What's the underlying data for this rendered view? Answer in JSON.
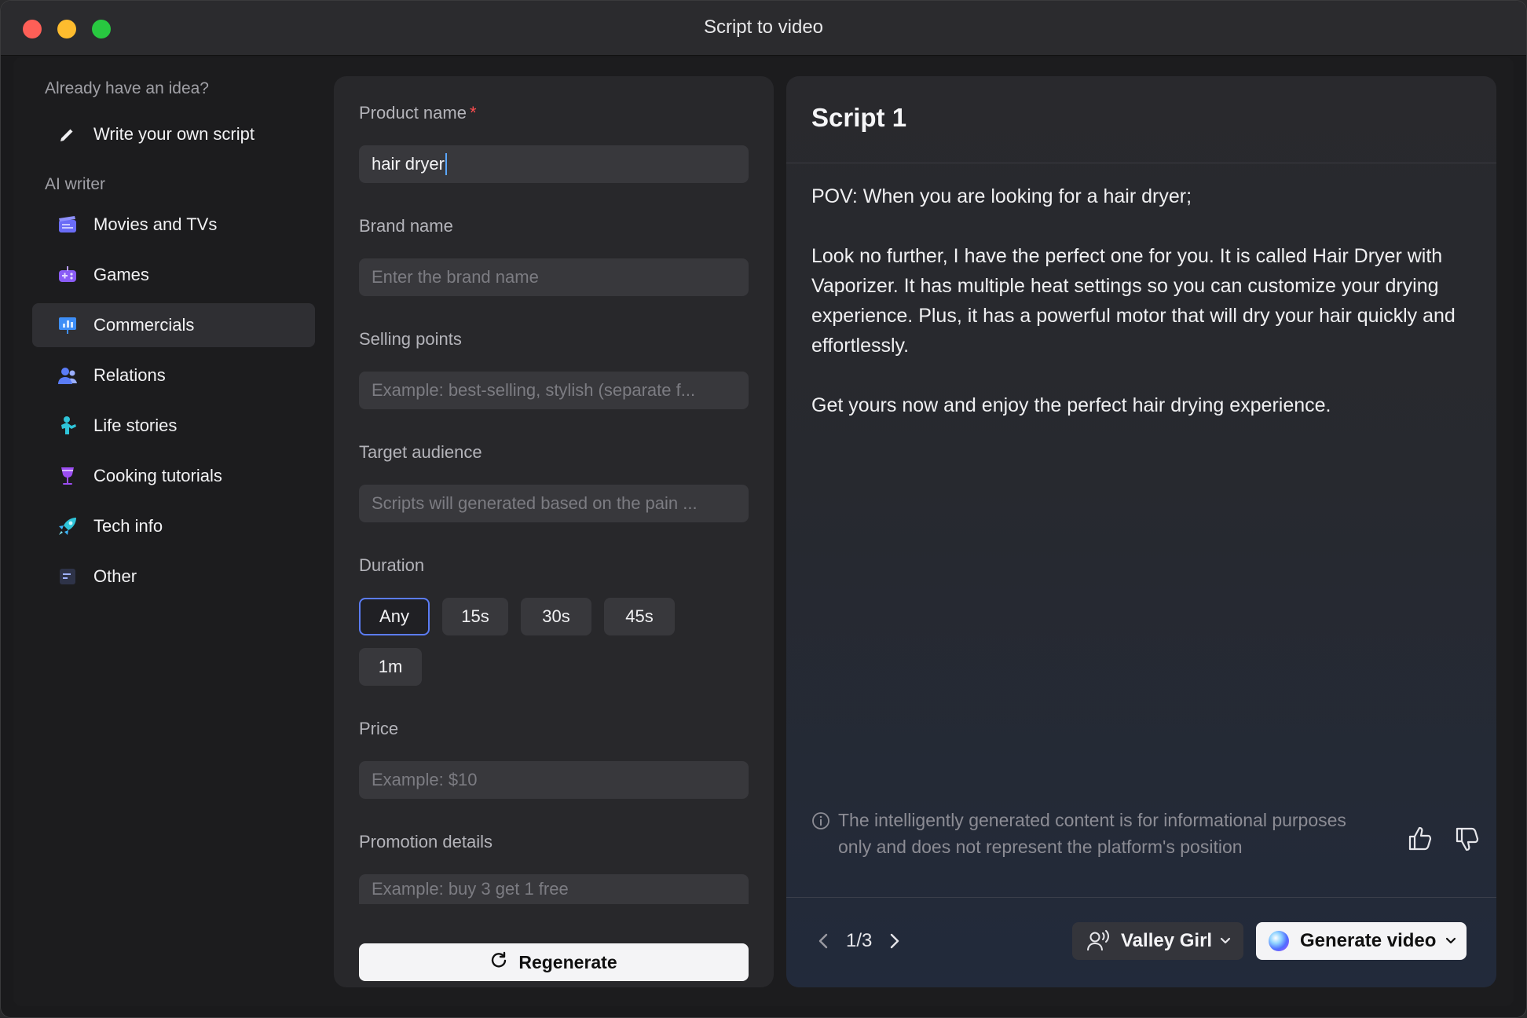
{
  "window": {
    "title": "Script to video"
  },
  "sidebar": {
    "idea_label": "Already have an idea?",
    "write_own": "Write your own script",
    "ai_writer_label": "AI writer",
    "items": [
      {
        "label": "Movies and TVs",
        "icon": "clapperboard-icon",
        "active": false
      },
      {
        "label": "Games",
        "icon": "gamepad-icon",
        "active": false
      },
      {
        "label": "Commercials",
        "icon": "presentation-chart-icon",
        "active": true
      },
      {
        "label": "Relations",
        "icon": "people-icon",
        "active": false
      },
      {
        "label": "Life stories",
        "icon": "person-life-icon",
        "active": false
      },
      {
        "label": "Cooking tutorials",
        "icon": "wine-glass-icon",
        "active": false
      },
      {
        "label": "Tech info",
        "icon": "rocket-icon",
        "active": false
      },
      {
        "label": "Other",
        "icon": "document-lines-icon",
        "active": false
      }
    ]
  },
  "form": {
    "product_name": {
      "label": "Product name",
      "required_mark": "*",
      "value": "hair dryer"
    },
    "brand_name": {
      "label": "Brand name",
      "placeholder": "Enter the brand name"
    },
    "selling_points": {
      "label": "Selling points",
      "placeholder": "Example: best-selling, stylish (separate f..."
    },
    "target_audience": {
      "label": "Target audience",
      "placeholder": "Scripts will generated based on the pain ..."
    },
    "duration": {
      "label": "Duration",
      "options": [
        "Any",
        "15s",
        "30s",
        "45s",
        "1m"
      ],
      "selected": "Any"
    },
    "price": {
      "label": "Price",
      "placeholder": "Example: $10"
    },
    "promotion": {
      "label": "Promotion details",
      "placeholder": "Example: buy 3 get 1 free"
    },
    "regenerate_label": "Regenerate"
  },
  "script": {
    "title": "Script 1",
    "paragraphs": [
      "POV: When you are looking for a hair dryer;",
      "Look no further, I have the perfect one for you. It is called Hair Dryer with Vaporizer. It has multiple heat settings so you can customize your drying experience. Plus, it has a powerful motor that will dry your hair quickly and effortlessly.",
      "Get yours now and enjoy the perfect hair drying experience."
    ],
    "disclaimer": "The intelligently generated content is for informational purposes only and does not represent the platform's position",
    "page": "1/3",
    "voice": "Valley Girl",
    "generate_label": "Generate video"
  },
  "colors": {
    "accent": "#5b7cf5",
    "required": "#ff4d4f",
    "caret": "#5aa7ff"
  }
}
